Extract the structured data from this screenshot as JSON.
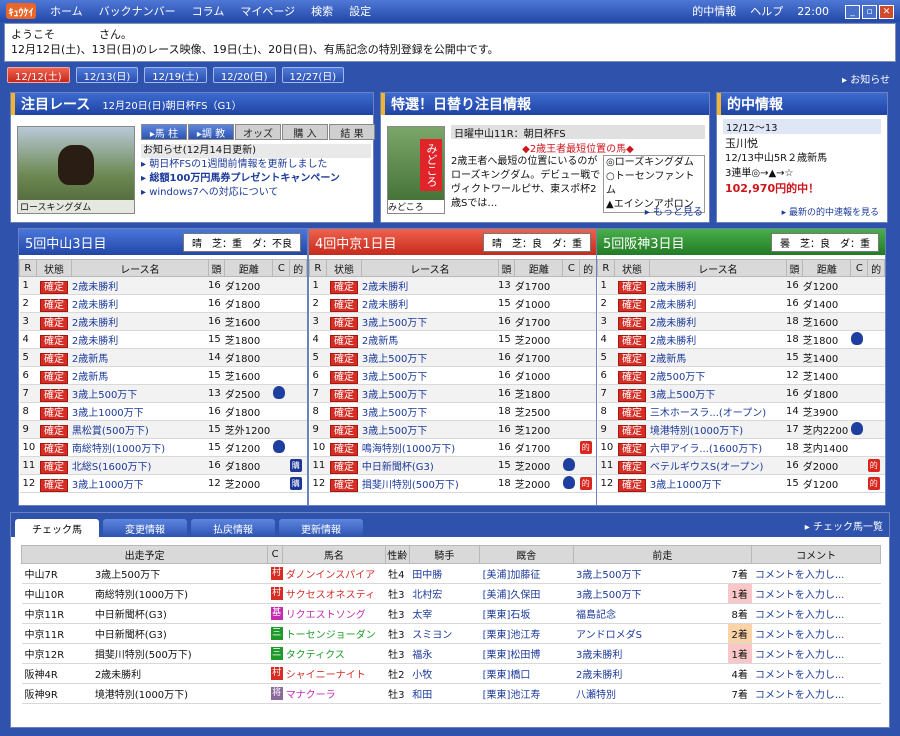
{
  "titlebar": {
    "logo": "ｷｭｳｹｲ",
    "menu": [
      "ホーム",
      "バックナンバー",
      "コラム",
      "マイページ",
      "検索",
      "設定"
    ],
    "right": [
      "的中情報",
      "ヘルプ",
      "22:00"
    ]
  },
  "welcome": {
    "line1": "ようこそ　　　　さん。",
    "line2": "12月12日(土)、13日(日)のレース映像、19日(土)、20日(日)、有馬記念の特別登録を公開中です。"
  },
  "dates": [
    "12/12(土)",
    "12/13(日)",
    "12/19(土)",
    "12/20(日)",
    "12/27(日)"
  ],
  "info_link": "▸ お知らせ",
  "featured": {
    "title": "注目レース",
    "subtitle": "12月20日(日)朝日杯FS（G1）",
    "image_caption": "ロースキングダム",
    "tabs": [
      "▸馬 柱",
      "▸調 教",
      "オッズ",
      "購 入",
      "結 果"
    ],
    "news_head": "お知らせ(12月14日更新)",
    "news": [
      "▸ 朝日杯FSの1週間前情報を更新しました",
      "▸ 総額100万円馬券プレゼントキャンペーン",
      "▸ windows7への対応について"
    ]
  },
  "special": {
    "title": "特選！日替り注目情報",
    "image_tag": "みどころ",
    "image_caption": "みどころ",
    "head": "日曜中山11R：朝日杯FS",
    "red": "◆2歳王者最短位置の馬◆",
    "text": "2歳王者へ最短の位置にいるのがローズキングダム。デビュー戦でヴィクトワールピサ、東スポ杯2歳Sでは…",
    "marks": [
      "◎ローズキングダム",
      "○トーセンファントム",
      "▲エイシンアポロン"
    ],
    "more": "▸ もっと見る"
  },
  "hit": {
    "title": "的中情報",
    "date": "12/12〜13",
    "name": "玉川悦",
    "line1": "12/13中山5R２歳新馬",
    "line2": "3連単◎→▲→☆",
    "amount": "102,970円的中！",
    "link": "▸ 最新の的中速報を見る"
  },
  "venues": [
    {
      "name": "5回中山3日目",
      "cond": "晴　芝：重　ダ：不良",
      "headers": [
        "R",
        "状態",
        "レース名",
        "頭",
        "距離",
        "C",
        "的"
      ],
      "races": [
        {
          "r": "1",
          "status": "確定",
          "name": "2歳未勝利",
          "heads": "16",
          "dist": "ダ1200",
          "c": "",
          "hit": ""
        },
        {
          "r": "2",
          "status": "確定",
          "name": "2歳未勝利",
          "heads": "16",
          "dist": "ダ1800",
          "c": "",
          "hit": ""
        },
        {
          "r": "3",
          "status": "確定",
          "name": "2歳未勝利",
          "heads": "16",
          "dist": "芝1600",
          "c": "",
          "hit": ""
        },
        {
          "r": "4",
          "status": "確定",
          "name": "2歳未勝利",
          "heads": "15",
          "dist": "芝1800",
          "c": "",
          "hit": ""
        },
        {
          "r": "5",
          "status": "確定",
          "name": "2歳新馬",
          "heads": "14",
          "dist": "ダ1800",
          "c": "",
          "hit": ""
        },
        {
          "r": "6",
          "status": "確定",
          "name": "2歳新馬",
          "heads": "15",
          "dist": "芝1600",
          "c": "",
          "hit": ""
        },
        {
          "r": "7",
          "status": "確定",
          "name": "3歳上500万下",
          "heads": "13",
          "dist": "ダ2500",
          "c": "mask",
          "hit": ""
        },
        {
          "r": "8",
          "status": "確定",
          "name": "3歳上1000万下",
          "heads": "16",
          "dist": "ダ1800",
          "c": "",
          "hit": ""
        },
        {
          "r": "9",
          "status": "確定",
          "name": "黒松賞(500万下)",
          "heads": "15",
          "dist": "芝外1200",
          "c": "",
          "hit": ""
        },
        {
          "r": "10",
          "status": "確定",
          "name": "南総特別(1000万下)",
          "heads": "15",
          "dist": "ダ1200",
          "c": "mask",
          "hit": ""
        },
        {
          "r": "11",
          "status": "確定",
          "name": "北総S(1600万下)",
          "heads": "16",
          "dist": "ダ1800",
          "c": "",
          "hit": "ck"
        },
        {
          "r": "12",
          "status": "確定",
          "name": "3歳上1000万下",
          "heads": "12",
          "dist": "芝2000",
          "c": "",
          "hit": "ck"
        }
      ]
    },
    {
      "name": "4回中京1日目",
      "cond": "晴　芝：良　ダ：重",
      "headers": [
        "R",
        "状態",
        "レース名",
        "頭",
        "距離",
        "C",
        "的"
      ],
      "races": [
        {
          "r": "1",
          "status": "確定",
          "name": "2歳未勝利",
          "heads": "13",
          "dist": "ダ1700",
          "c": "",
          "hit": ""
        },
        {
          "r": "2",
          "status": "確定",
          "name": "2歳未勝利",
          "heads": "15",
          "dist": "ダ1000",
          "c": "",
          "hit": ""
        },
        {
          "r": "3",
          "status": "確定",
          "name": "3歳上500万下",
          "heads": "16",
          "dist": "ダ1700",
          "c": "",
          "hit": ""
        },
        {
          "r": "4",
          "status": "確定",
          "name": "2歳新馬",
          "heads": "15",
          "dist": "芝2000",
          "c": "",
          "hit": ""
        },
        {
          "r": "5",
          "status": "確定",
          "name": "3歳上500万下",
          "heads": "16",
          "dist": "ダ1700",
          "c": "",
          "hit": ""
        },
        {
          "r": "6",
          "status": "確定",
          "name": "3歳上500万下",
          "heads": "16",
          "dist": "ダ1000",
          "c": "",
          "hit": ""
        },
        {
          "r": "7",
          "status": "確定",
          "name": "3歳上500万下",
          "heads": "16",
          "dist": "芝1800",
          "c": "",
          "hit": ""
        },
        {
          "r": "8",
          "status": "確定",
          "name": "3歳上500万下",
          "heads": "18",
          "dist": "芝2500",
          "c": "",
          "hit": ""
        },
        {
          "r": "9",
          "status": "確定",
          "name": "3歳上500万下",
          "heads": "16",
          "dist": "芝1200",
          "c": "",
          "hit": ""
        },
        {
          "r": "10",
          "status": "確定",
          "name": "鳴海特別(1000万下)",
          "heads": "16",
          "dist": "ダ1700",
          "c": "",
          "hit": "hit"
        },
        {
          "r": "11",
          "status": "確定",
          "name": "中日新聞杯(G3)",
          "heads": "15",
          "dist": "芝2000",
          "c": "mask",
          "hit": ""
        },
        {
          "r": "12",
          "status": "確定",
          "name": "揖斐川特別(500万下)",
          "heads": "18",
          "dist": "芝2000",
          "c": "mask",
          "hit": "hit"
        }
      ]
    },
    {
      "name": "5回阪神3日目",
      "cond": "曇　芝：良　ダ：重",
      "headers": [
        "R",
        "状態",
        "レース名",
        "頭",
        "距離",
        "C",
        "的"
      ],
      "races": [
        {
          "r": "1",
          "status": "確定",
          "name": "2歳未勝利",
          "heads": "16",
          "dist": "ダ1200",
          "c": "",
          "hit": ""
        },
        {
          "r": "2",
          "status": "確定",
          "name": "2歳未勝利",
          "heads": "16",
          "dist": "ダ1400",
          "c": "",
          "hit": ""
        },
        {
          "r": "3",
          "status": "確定",
          "name": "2歳未勝利",
          "heads": "18",
          "dist": "芝1600",
          "c": "",
          "hit": ""
        },
        {
          "r": "4",
          "status": "確定",
          "name": "2歳未勝利",
          "heads": "18",
          "dist": "芝1800",
          "c": "mask",
          "hit": ""
        },
        {
          "r": "5",
          "status": "確定",
          "name": "2歳新馬",
          "heads": "15",
          "dist": "芝1400",
          "c": "",
          "hit": ""
        },
        {
          "r": "6",
          "status": "確定",
          "name": "2歳500万下",
          "heads": "12",
          "dist": "芝1400",
          "c": "",
          "hit": ""
        },
        {
          "r": "7",
          "status": "確定",
          "name": "3歳上500万下",
          "heads": "16",
          "dist": "ダ1800",
          "c": "",
          "hit": ""
        },
        {
          "r": "8",
          "status": "確定",
          "name": "三木ホースラ...(オープン)",
          "heads": "14",
          "dist": "芝3900",
          "c": "",
          "hit": ""
        },
        {
          "r": "9",
          "status": "確定",
          "name": "境港特別(1000万下)",
          "heads": "17",
          "dist": "芝内2200",
          "c": "mask",
          "hit": ""
        },
        {
          "r": "10",
          "status": "確定",
          "name": "六甲アイラ...(1600万下)",
          "heads": "18",
          "dist": "芝内1400",
          "c": "",
          "hit": ""
        },
        {
          "r": "11",
          "status": "確定",
          "name": "ベテルギウスS(オープン)",
          "heads": "16",
          "dist": "ダ2000",
          "c": "",
          "hit": "hit"
        },
        {
          "r": "12",
          "status": "確定",
          "name": "3歳上1000万下",
          "heads": "15",
          "dist": "ダ1200",
          "c": "",
          "hit": "hit"
        }
      ]
    }
  ],
  "bottom": {
    "tabs": [
      "チェック馬",
      "変更情報",
      "払戻情報",
      "更新情報"
    ],
    "right_link": "▸ チェック馬一覧",
    "headers": [
      "出走予定",
      "C",
      "馬名",
      "性齢",
      "騎手",
      "厩舎",
      "前走",
      "コメント"
    ],
    "rows": [
      {
        "place": "中山7R",
        "race": "3歳上500万下",
        "c": "村",
        "ccolor": "#d62d25",
        "horse": "ダノンインスパイア",
        "hcolor": "#d62d25",
        "sex": "牡4",
        "jockey": "田中勝",
        "stable": "[美浦]加藤征",
        "prev": "3歳上500万下",
        "finish": "7着",
        "fclass": "",
        "comment": "コメントを入力し..."
      },
      {
        "place": "中山10R",
        "race": "南総特別(1000万下)",
        "c": "村",
        "ccolor": "#d62d25",
        "horse": "サクセスオネスティ",
        "hcolor": "#d62d25",
        "sex": "牡3",
        "jockey": "北村宏",
        "stable": "[美浦]久保田",
        "prev": "3歳上500万下",
        "finish": "1着",
        "fclass": "pink",
        "comment": "コメントを入力し..."
      },
      {
        "place": "中京11R",
        "race": "中日新聞杯(G3)",
        "c": "基",
        "ccolor": "#c52ab0",
        "horse": "リクエストソング",
        "hcolor": "#c52ab0",
        "sex": "牡3",
        "jockey": "太宰",
        "stable": "[栗東]石坂",
        "prev": "福島記念",
        "finish": "8着",
        "fclass": "",
        "comment": "コメントを入力し..."
      },
      {
        "place": "中京11R",
        "race": "中日新聞杯(G3)",
        "c": "三",
        "ccolor": "#1e9a2a",
        "horse": "トーセンジョーダン",
        "hcolor": "#1e9a2a",
        "sex": "牡3",
        "jockey": "スミヨン",
        "stable": "[栗東]池江寿",
        "prev": "アンドロメダS",
        "finish": "2着",
        "fclass": "orange",
        "comment": "コメントを入力し..."
      },
      {
        "place": "中京12R",
        "race": "揖斐川特別(500万下)",
        "c": "三",
        "ccolor": "#1e9a2a",
        "horse": "タクティクス",
        "hcolor": "#1e9a2a",
        "sex": "牡3",
        "jockey": "福永",
        "stable": "[栗東]松田博",
        "prev": "3歳未勝利",
        "finish": "1着",
        "fclass": "pink",
        "comment": "コメントを入力し..."
      },
      {
        "place": "阪神4R",
        "race": "2歳未勝利",
        "c": "村",
        "ccolor": "#d62d25",
        "horse": "シャイニーナイト",
        "hcolor": "#d62d25",
        "sex": "牡2",
        "jockey": "小牧",
        "stable": "[栗東]橋口",
        "prev": "2歳未勝利",
        "finish": "4着",
        "fclass": "",
        "comment": "コメントを入力し..."
      },
      {
        "place": "阪神9R",
        "race": "境港特別(1000万下)",
        "c": "将",
        "ccolor": "#8a6a9a",
        "horse": "マナクーラ",
        "hcolor": "#c52ab0",
        "sex": "牡3",
        "jockey": "和田",
        "stable": "[栗東]池江寿",
        "prev": "八瀬特別",
        "finish": "7着",
        "fclass": "",
        "comment": "コメントを入力し..."
      }
    ]
  }
}
